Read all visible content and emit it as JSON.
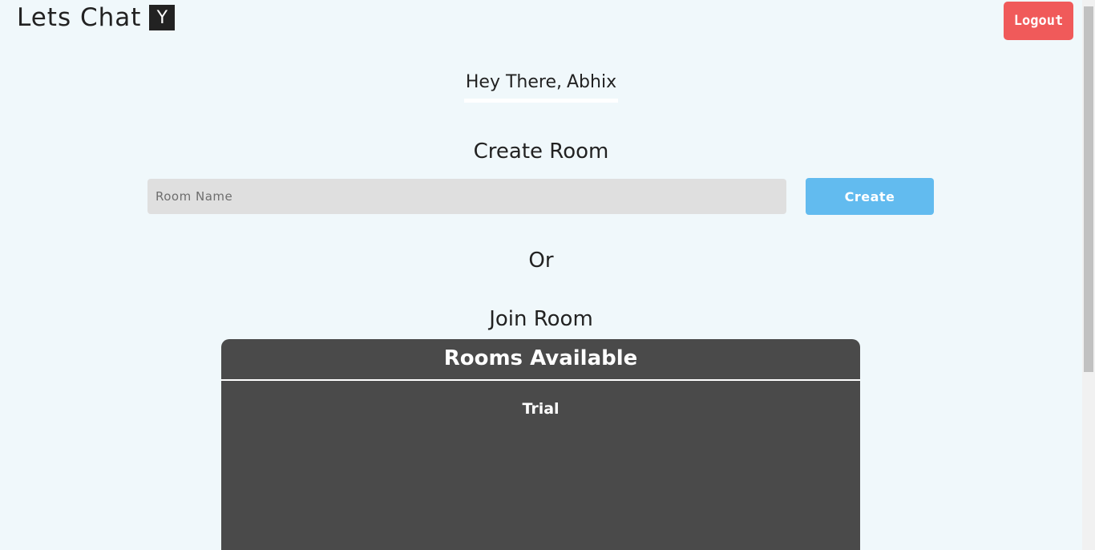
{
  "header": {
    "title": "Lets Chat",
    "logo_glyph": "Y",
    "logout_label": "Logout"
  },
  "greeting": {
    "prefix": "Hey There,",
    "username": "Abhix"
  },
  "create_room": {
    "heading": "Create Room",
    "input_placeholder": "Room Name",
    "input_value": "",
    "button_label": "Create"
  },
  "separator": {
    "label": "Or"
  },
  "join_room": {
    "heading": "Join Room",
    "panel_title": "Rooms Available",
    "rooms": [
      "Trial"
    ]
  },
  "colors": {
    "background": "#f0f8fb",
    "logout": "#f05a5a",
    "create_button": "#62bbef",
    "panel": "#4a4a4a",
    "input": "#dfdfdf"
  }
}
